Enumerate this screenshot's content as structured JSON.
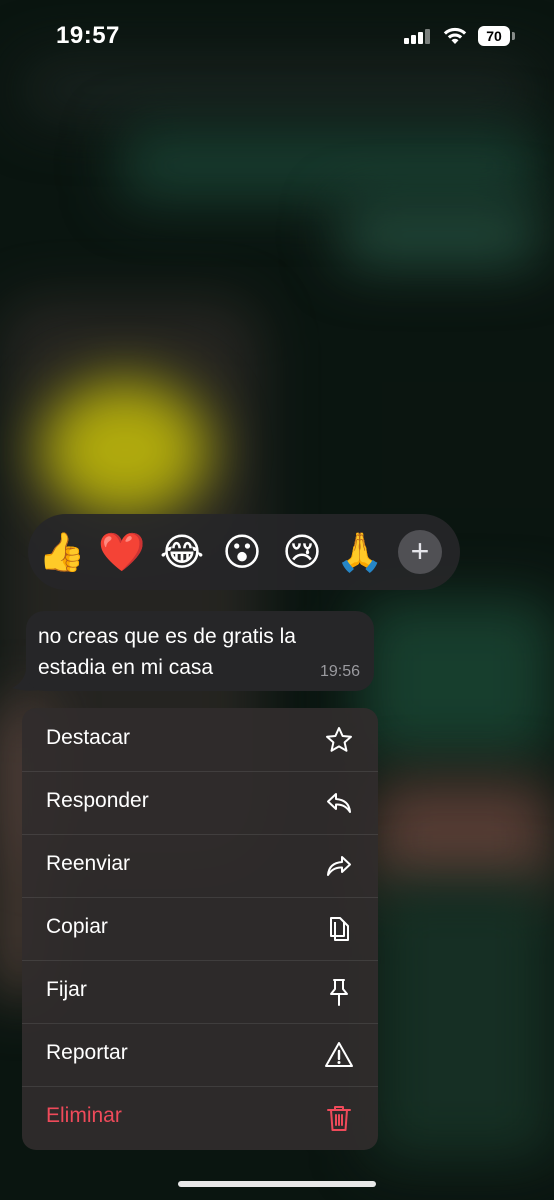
{
  "status_bar": {
    "time": "19:57",
    "battery": "70"
  },
  "reactions": {
    "emojis": [
      "👍",
      "❤️",
      "😂",
      "😮",
      "😢",
      "🙏"
    ],
    "more_label": "+"
  },
  "message": {
    "text": "no creas que es de gratis la estadia en mi casa",
    "time": "19:56"
  },
  "menu": {
    "items": [
      {
        "label": "Destacar",
        "icon": "star-icon"
      },
      {
        "label": "Responder",
        "icon": "reply-icon"
      },
      {
        "label": "Reenviar",
        "icon": "forward-icon"
      },
      {
        "label": "Copiar",
        "icon": "copy-icon"
      },
      {
        "label": "Fijar",
        "icon": "pin-icon"
      },
      {
        "label": "Reportar",
        "icon": "warning-icon"
      },
      {
        "label": "Eliminar",
        "icon": "trash-icon"
      }
    ],
    "danger_color": "#ef4a5a"
  }
}
